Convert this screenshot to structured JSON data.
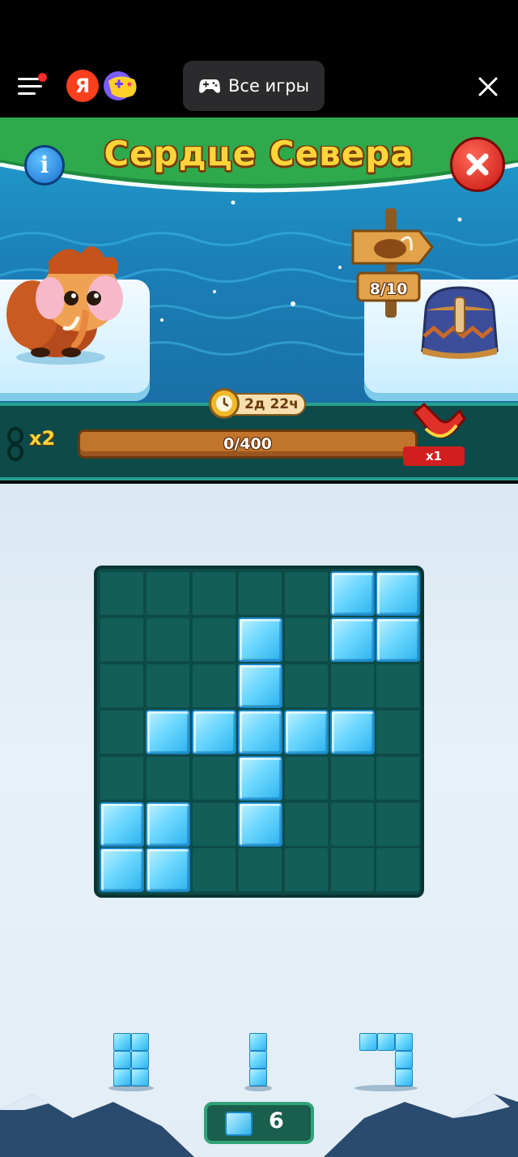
{
  "topbar": {
    "all_games_label": "Все игры",
    "ya_logo_letter": "Я"
  },
  "game": {
    "title": "Сердце Севера",
    "info_label": "i",
    "event_progress": "8/10",
    "timer": "2д 22ч",
    "score_multiplier": "x2",
    "progress_text": "0/400",
    "progress_fraction": 0.0,
    "magnet_count": "x1",
    "moves_left": "6"
  },
  "board": {
    "rows": 7,
    "cols": 7,
    "ice_cells": [
      [
        0,
        5
      ],
      [
        0,
        6
      ],
      [
        1,
        3
      ],
      [
        1,
        5
      ],
      [
        1,
        6
      ],
      [
        2,
        3
      ],
      [
        3,
        1
      ],
      [
        3,
        2
      ],
      [
        3,
        3
      ],
      [
        3,
        4
      ],
      [
        3,
        5
      ],
      [
        4,
        3
      ],
      [
        5,
        0
      ],
      [
        5,
        1
      ],
      [
        5,
        3
      ],
      [
        6,
        0
      ],
      [
        6,
        1
      ]
    ]
  },
  "pieces": [
    {
      "name": "piece-2x3",
      "cells": [
        [
          0,
          0
        ],
        [
          0,
          1
        ],
        [
          1,
          0
        ],
        [
          1,
          1
        ],
        [
          2,
          0
        ],
        [
          2,
          1
        ]
      ]
    },
    {
      "name": "piece-1x3",
      "cells": [
        [
          0,
          0
        ],
        [
          1,
          0
        ],
        [
          2,
          0
        ]
      ]
    },
    {
      "name": "piece-corner",
      "cells": [
        [
          0,
          0
        ],
        [
          0,
          1
        ],
        [
          0,
          2
        ],
        [
          1,
          2
        ],
        [
          2,
          2
        ]
      ]
    }
  ],
  "colors": {
    "title_gold": "#ffd53a",
    "board_bg": "#0d4b47",
    "ice_blue": "#6ed8ff",
    "close_red": "#c7130e",
    "info_blue": "#1b6fd0",
    "progress_brown": "#c1752c"
  }
}
